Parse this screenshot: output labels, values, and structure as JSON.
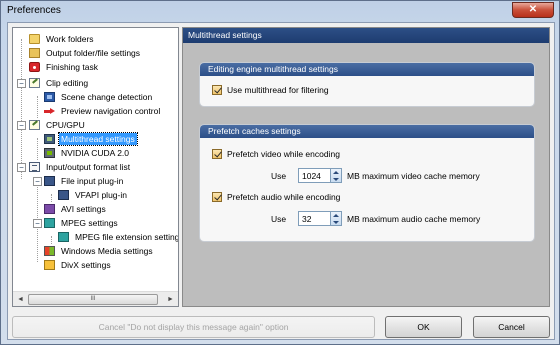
{
  "window": {
    "title": "Preferences",
    "close_glyph": "✕"
  },
  "tree": {
    "items": [
      {
        "label": "Work folders",
        "icon": "folder-icon"
      },
      {
        "label": "Output folder/file settings",
        "icon": "folder-settings-icon"
      },
      {
        "label": "Finishing task",
        "icon": "finishing-task-icon"
      },
      {
        "label": "Clip editing",
        "icon": "edit-icon"
      },
      {
        "label": "Scene change detection",
        "icon": "scene-icon"
      },
      {
        "label": "Preview navigation control",
        "icon": "arrow-icon"
      },
      {
        "label": "CPU/GPU",
        "icon": "edit-icon"
      },
      {
        "label": "Multithread settings",
        "icon": "chip-icon"
      },
      {
        "label": "NVIDIA CUDA 2.0",
        "icon": "nvidia-icon"
      },
      {
        "label": "Input/output format list",
        "icon": "list-icon"
      },
      {
        "label": "File input plug-in",
        "icon": "monitor-icon"
      },
      {
        "label": "VFAPI plug-in",
        "icon": "monitor-icon"
      },
      {
        "label": "AVI settings",
        "icon": "film-icon"
      },
      {
        "label": "MPEG settings",
        "icon": "mpeg-icon"
      },
      {
        "label": "MPEG file extension setting",
        "icon": "mpeg-icon"
      },
      {
        "label": "Windows Media settings",
        "icon": "windows-media-icon"
      },
      {
        "label": "DivX settings",
        "icon": "divx-icon"
      }
    ],
    "scroll_left": "◄",
    "scroll_right": "►",
    "scroll_grip": "III"
  },
  "panel": {
    "title": "Multithread settings",
    "editing_group": {
      "title": "Editing engine multithread settings",
      "use_multithread_label": "Use multithread for filtering",
      "use_multithread_checked": true
    },
    "prefetch_group": {
      "title": "Prefetch caches settings",
      "video_label": "Prefetch video while encoding",
      "video_checked": true,
      "video_use_label": "Use",
      "video_value": "1024",
      "video_suffix": "MB maximum video cache memory",
      "audio_label": "Prefetch audio while encoding",
      "audio_checked": true,
      "audio_use_label": "Use",
      "audio_value": "32",
      "audio_suffix": "MB maximum audio cache memory"
    }
  },
  "footer": {
    "cancel_message_label": "Cancel \"Do not display this message again\" option",
    "ok_label": "OK",
    "cancel_label": "Cancel"
  }
}
